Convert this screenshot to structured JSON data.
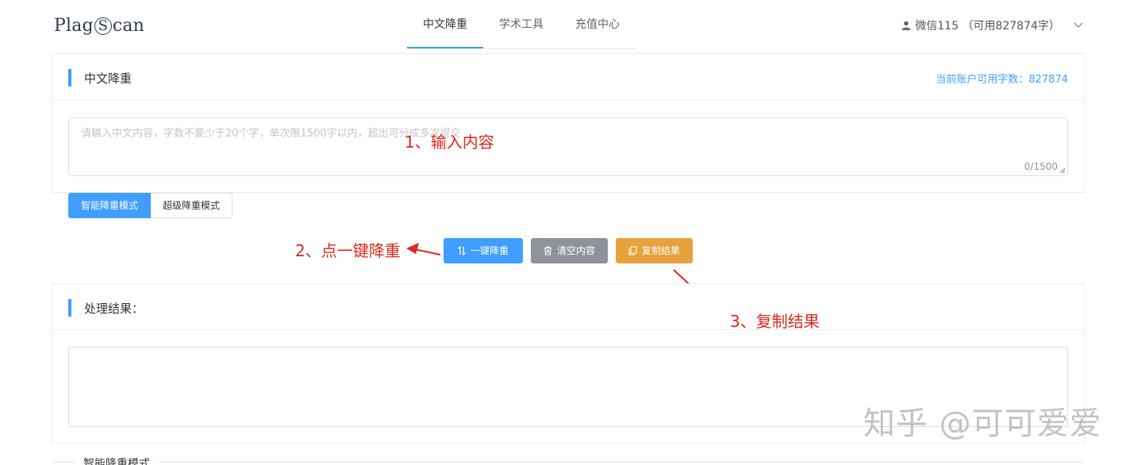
{
  "logo": {
    "text_before": "Plag",
    "letter": "S",
    "text_after": "can"
  },
  "nav": {
    "tabs": [
      {
        "label": "中文降重"
      },
      {
        "label": "学术工具"
      },
      {
        "label": "充值中心"
      }
    ]
  },
  "user": {
    "label": "微信115 （可用827874字）"
  },
  "input_card": {
    "title": "中文降重",
    "quota": "当前账户可用字数：827874",
    "placeholder": "请输入中文内容，字数不要少于20个字，单次限1500字以内，超出可分成多次提交",
    "counter": "0/1500"
  },
  "modes": {
    "smart": "智能降重模式",
    "super": "超级降重模式"
  },
  "buttons": {
    "reduce": "一键降重",
    "clear": "清空内容",
    "copy": "复制结果"
  },
  "annotations": {
    "step1": "1、输入内容",
    "step2": "2、点一键降重",
    "step3": "3、复制结果"
  },
  "result_card": {
    "title": "处理结果："
  },
  "bottom_section": {
    "label": "智能降重模式"
  },
  "watermark": "知乎 @可可爱爱",
  "colors": {
    "primary": "#409eff",
    "gray": "#909399",
    "orange": "#e6a23c",
    "annotation": "#e0261b"
  }
}
